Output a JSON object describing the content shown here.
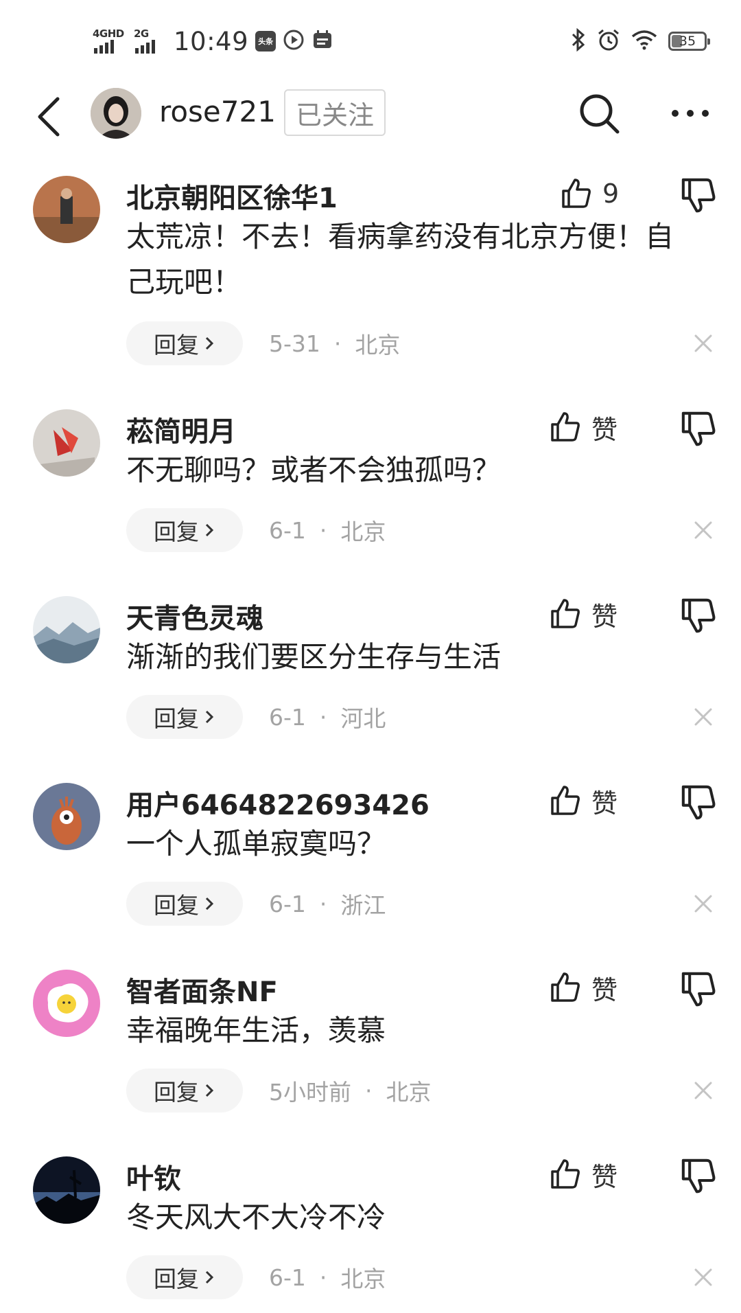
{
  "status_bar": {
    "network1": "4GHD",
    "network2": "2G",
    "time": "10:49",
    "app_icon_label": "头条",
    "battery": "35",
    "icons": [
      "signal-4g-icon",
      "signal-2g-icon",
      "toutiao-icon",
      "video-icon",
      "calendar-icon",
      "bluetooth-icon",
      "alarm-icon",
      "wifi-icon",
      "battery-icon"
    ]
  },
  "header": {
    "username": "rose721",
    "follow_label": "已关注",
    "icons": [
      "back-icon",
      "search-icon",
      "more-icon"
    ]
  },
  "comments": [
    {
      "name": "北京朝阳区徐华1",
      "text": "太荒凉！不去！看病拿药没有北京方便！自己玩吧！",
      "like": "9",
      "reply": "回复",
      "date": "5-31",
      "dot": "·",
      "location": "北京"
    },
    {
      "name": "菘简明月",
      "text": "不无聊吗？或者不会独孤吗？",
      "like": "赞",
      "reply": "回复",
      "date": "6-1",
      "dot": "·",
      "location": "北京"
    },
    {
      "name": "天青色灵魂",
      "text": "渐渐的我们要区分生存与生活",
      "like": "赞",
      "reply": "回复",
      "date": "6-1",
      "dot": "·",
      "location": "河北"
    },
    {
      "name": "用户6464822693426",
      "text": "一个人孤单寂寞吗？",
      "like": "赞",
      "reply": "回复",
      "date": "6-1",
      "dot": "·",
      "location": "浙江"
    },
    {
      "name": "智者面条NF",
      "text": "幸福晚年生活，羡慕",
      "like": "赞",
      "reply": "回复",
      "date": "5小时前",
      "dot": "·",
      "location": "北京"
    },
    {
      "name": "叶钦",
      "text": "冬天风大不大冷不冷",
      "like": "赞",
      "reply": "回复",
      "date": "6-1",
      "dot": "·",
      "location": "北京"
    }
  ],
  "colors": {
    "text_primary": "#222222",
    "text_secondary": "#a3a3a3",
    "reply_bg": "#f5f5f5",
    "follow_border": "#d9d9d9"
  }
}
